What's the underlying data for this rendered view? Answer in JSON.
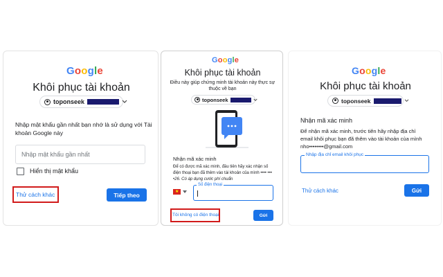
{
  "logo": [
    "G",
    "o",
    "o",
    "g",
    "l",
    "e"
  ],
  "panel1": {
    "title": "Khôi phục tài khoản",
    "account": "toponseek",
    "instruction_line1": "Nhập mật khẩu gần nhất bạn nhớ là sử dụng với Tài",
    "instruction_line2": "khoản Google này",
    "password_placeholder": "Nhập mật khẩu gần nhất",
    "show_password_label": "Hiển thị mật khẩu",
    "try_another_label": "Thử cách khác",
    "next_label": "Tiếp theo"
  },
  "panel2": {
    "title": "Khôi phục tài khoản",
    "subtitle_line1": "Điều này giúp chứng minh tài khoản này thực sự",
    "subtitle_line2": "thuộc về bạn",
    "account": "toponseek",
    "section_heading": "Nhận mã xác minh",
    "desc_line1": "Để có được mã xác minh, đầu tiên hãy xác nhận số",
    "desc_line2": "điện thoại bạn đã thêm vào tài khoản của mình •••• •••",
    "desc_line3": "•26. Có áp dụng cước phí chuẩn",
    "phone_label": "Số điện thoại",
    "no_phone_label": "Tôi không có điện thoại",
    "send_label": "Gửi"
  },
  "panel3": {
    "title": "Khôi phục tài khoản",
    "account": "toponseek",
    "section_heading": "Nhận mã xác minh",
    "desc_line1": "Để nhận mã xác minh, trước tiên hãy nhập địa chỉ",
    "desc_line2": "email khôi phục bạn đã thêm vào tài khoản của mình",
    "desc_line3": "nho••••••••@gmail.com",
    "email_label": "Nhập địa chỉ email khôi phục",
    "try_another_label": "Thử cách khác",
    "send_label": "Gửi"
  },
  "colors": {
    "primary": "#1a73e8",
    "highlight_box": "#d11a1a",
    "redaction": "#1a1a6e"
  }
}
